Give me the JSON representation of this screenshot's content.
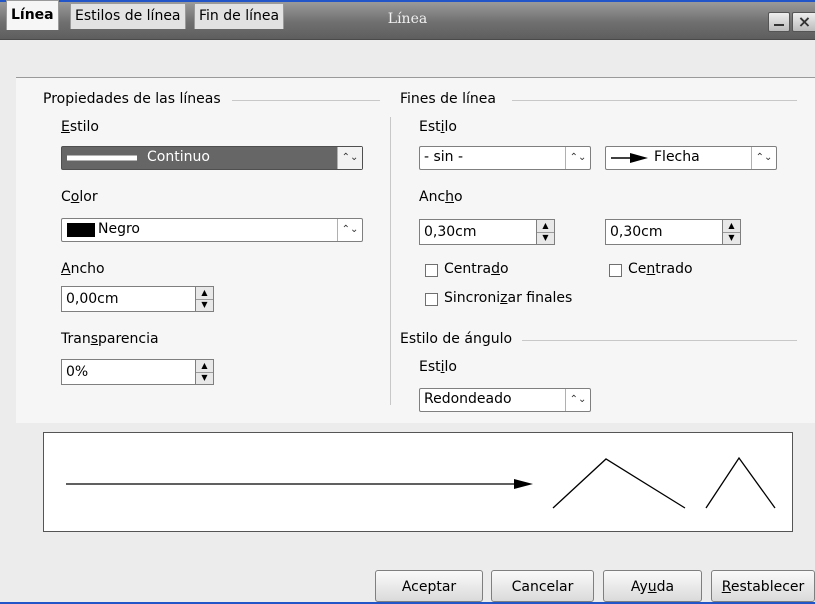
{
  "window": {
    "title": "Línea"
  },
  "tabs": [
    {
      "label": "Línea",
      "active": true
    },
    {
      "label": "Estilos de línea",
      "active": false
    },
    {
      "label": "Fin de línea",
      "active": false
    }
  ],
  "line_properties": {
    "section_title": "Propiedades de las líneas",
    "style_label_ul": "E",
    "style_label_rest": "stilo",
    "style_value": "Continuo",
    "color_label_a": "C",
    "color_label_ul": "o",
    "color_label_b": "lor",
    "color_value": "Negro",
    "color_swatch": "#000000",
    "width_label_ul": "A",
    "width_label_rest": "ncho",
    "width_value": "0,00cm",
    "transparency_label_a": "Tran",
    "transparency_label_ul": "s",
    "transparency_label_b": "parencia",
    "transparency_value": "0%"
  },
  "line_ends": {
    "section_title": "Fines de línea",
    "style_label_a": "Est",
    "style_label_ul": "i",
    "style_label_b": "lo",
    "start_style_value": "- sin -",
    "end_style_value": "Flecha",
    "width_label_a": "Anc",
    "width_label_ul": "h",
    "width_label_b": "o",
    "start_width_value": "0,30cm",
    "end_width_value": "0,30cm",
    "start_center_a": "Centra",
    "start_center_ul": "d",
    "start_center_b": "o",
    "start_center_checked": false,
    "end_center_a": "Ce",
    "end_center_ul": "n",
    "end_center_b": "trado",
    "end_center_checked": false,
    "sync_a": "Sincroni",
    "sync_ul": "z",
    "sync_b": "ar finales",
    "sync_checked": false
  },
  "corner_style": {
    "section_title": "Estilo de ángulo",
    "style_label_a": "Est",
    "style_label_ul": "i",
    "style_label_b": "lo",
    "style_value": "Redondeado"
  },
  "buttons": {
    "ok": "Aceptar",
    "cancel": "Cancelar",
    "help_a": "Ay",
    "help_ul": "u",
    "help_b": "da",
    "reset_ul": "R",
    "reset_rest": "establecer"
  },
  "icons": {
    "dropdown": "updown-chevron-icon",
    "spin_up": "triangle-up-icon",
    "spin_down": "triangle-down-icon",
    "arrow_end": "arrow-head-icon"
  },
  "colors": {
    "title_bar": "#6f6f6f",
    "selected_dropdown": "#666666",
    "accent_edge": "#2255c8"
  }
}
